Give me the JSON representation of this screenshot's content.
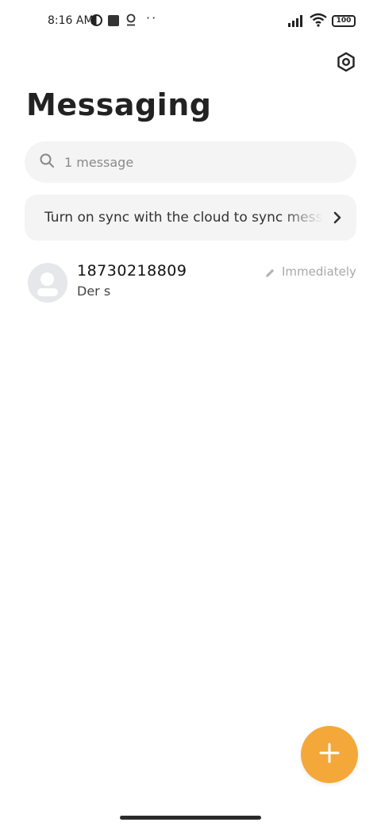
{
  "status_bar": {
    "time": "8:16 AM",
    "battery": "100"
  },
  "header": {
    "title": "Messaging",
    "settings_icon": "settings-hexagon-icon"
  },
  "search": {
    "placeholder": "1 message",
    "icon": "search-icon"
  },
  "sync_banner": {
    "text": "Turn on sync with the cloud to sync messages",
    "icon": "chevron-right-icon"
  },
  "conversations": [
    {
      "name": "18730218809",
      "preview": "Der s",
      "time": "Immediately",
      "draft_icon": "pencil-icon"
    }
  ],
  "fab": {
    "icon": "plus-icon",
    "color": "#f4a83a"
  },
  "colors": {
    "accent": "#f4a83a",
    "surface": "#f4f4f4",
    "muted_text": "#a8a8a8"
  }
}
